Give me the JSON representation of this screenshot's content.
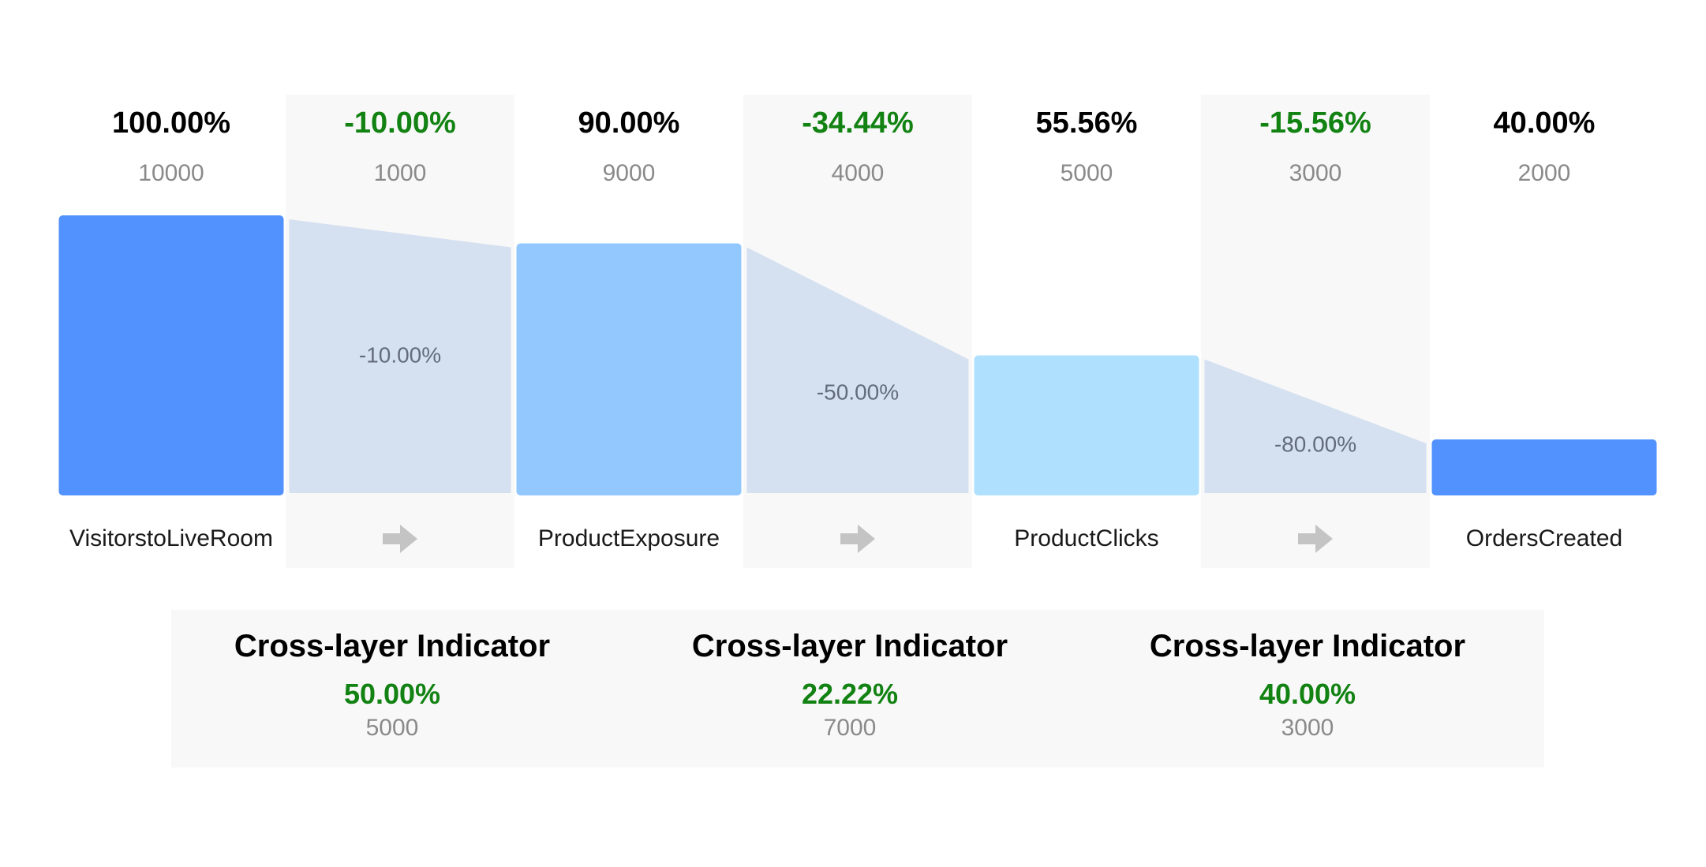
{
  "chart_data": {
    "type": "bar",
    "categories": [
      "VisitorstoLiveRoom",
      "ProductExposure",
      "ProductClicks",
      "OrdersCreated"
    ],
    "values": [
      10000,
      9000,
      5000,
      2000
    ],
    "value_percents": [
      "100.00%",
      "90.00%",
      "55.56%",
      "40.00%"
    ],
    "value_labels": [
      "10000",
      "9000",
      "5000",
      "2000"
    ],
    "ylim": [
      0,
      10000
    ],
    "bar_colors": [
      "#5192fe",
      "#92c8fe",
      "#afe0fe",
      "#5192fe"
    ],
    "transitions": [
      {
        "change_percent": "-10.00%",
        "change_value": "1000",
        "conversion_label": "-10.00%"
      },
      {
        "change_percent": "-34.44%",
        "change_value": "4000",
        "conversion_label": "-50.00%"
      },
      {
        "change_percent": "-15.56%",
        "change_value": "3000",
        "conversion_label": "-80.00%"
      }
    ],
    "cross_layer": [
      {
        "title": "Cross-layer Indicator",
        "percent": "50.00%",
        "value": "5000"
      },
      {
        "title": "Cross-layer Indicator",
        "percent": "22.22%",
        "value": "7000"
      },
      {
        "title": "Cross-layer Indicator",
        "percent": "40.00%",
        "value": "3000"
      }
    ],
    "colors": {
      "change_text": "#128212",
      "value_text": "#8a8a8a",
      "title_text": "#000000",
      "connector_fill": "#d5e1f0",
      "connector_text": "#646c7c",
      "panel_bg": "#f8f8f8",
      "arrow": "#c4c4c4"
    },
    "icons": {
      "transition_arrow": "arrow-right-icon"
    }
  }
}
